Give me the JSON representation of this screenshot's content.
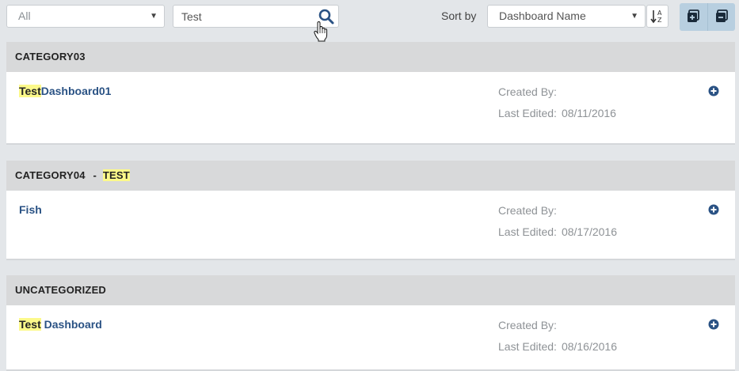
{
  "toolbar": {
    "filter": {
      "value": "All"
    },
    "search": {
      "value": "Test"
    },
    "sort_label": "Sort by",
    "sort": {
      "value": "Dashboard Name"
    }
  },
  "colors": {
    "link": "#2a5284",
    "highlight": "#fcf98a",
    "header_bg": "#d8d9da",
    "accent_button": "#b8cfe0",
    "page_bg": "#e3e6e9"
  },
  "icons": {
    "search": "search-icon",
    "sort_direction": "sort-alpha-ascending-icon",
    "expand_all": "expand-all-icon",
    "collapse_all": "collapse-all-icon",
    "add": "plus-circle-icon",
    "cursor": "hand-pointer-icon"
  },
  "categories": [
    {
      "title": "CATEGORY03",
      "title_suffix": "",
      "dashboards": [
        {
          "name_highlight": "Test",
          "name_rest": "Dashboard01",
          "created_by_label": "Created By:",
          "last_edited_label": "Last Edited:",
          "last_edited": "08/11/2016"
        }
      ]
    },
    {
      "title": "CATEGORY04",
      "title_separator": "-",
      "title_suffix": "TEST",
      "dashboards": [
        {
          "name_highlight": "",
          "name_rest": "Fish",
          "created_by_label": "Created By:",
          "last_edited_label": "Last Edited:",
          "last_edited": "08/17/2016"
        }
      ]
    },
    {
      "title": "UNCATEGORIZED",
      "title_suffix": "",
      "dashboards": [
        {
          "name_highlight": "Test",
          "name_rest": " Dashboard",
          "created_by_label": "Created By:",
          "last_edited_label": "Last Edited:",
          "last_edited": "08/16/2016"
        }
      ]
    }
  ]
}
